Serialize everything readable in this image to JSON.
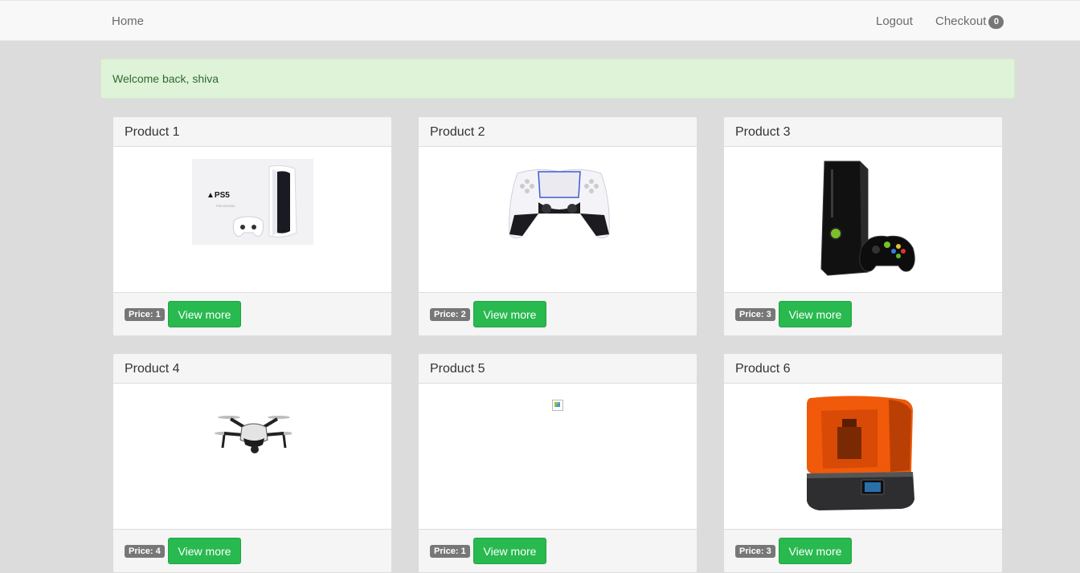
{
  "navbar": {
    "home": "Home",
    "logout": "Logout",
    "checkout": "Checkout",
    "cart_count": "0"
  },
  "alert": {
    "message": "Welcome back, shiva"
  },
  "products": [
    {
      "title": "Product 1",
      "price_label": "Price: 1",
      "button": "View more",
      "image": "ps5-console-box-icon"
    },
    {
      "title": "Product 2",
      "price_label": "Price: 2",
      "button": "View more",
      "image": "dualsense-controller-icon"
    },
    {
      "title": "Product 3",
      "price_label": "Price: 3",
      "button": "View more",
      "image": "xbox-360-console-icon"
    },
    {
      "title": "Product 4",
      "price_label": "Price: 4",
      "button": "View more",
      "image": "drone-icon"
    },
    {
      "title": "Product 5",
      "price_label": "Price: 1",
      "button": "View more",
      "image": "broken-image-icon"
    },
    {
      "title": "Product 6",
      "price_label": "Price: 3",
      "button": "View more",
      "image": "3d-printer-icon"
    }
  ],
  "colors": {
    "accent_button": "#28b94f",
    "alert_bg": "#dff3d8",
    "alert_text": "#2f6a30",
    "badge": "#777777"
  }
}
